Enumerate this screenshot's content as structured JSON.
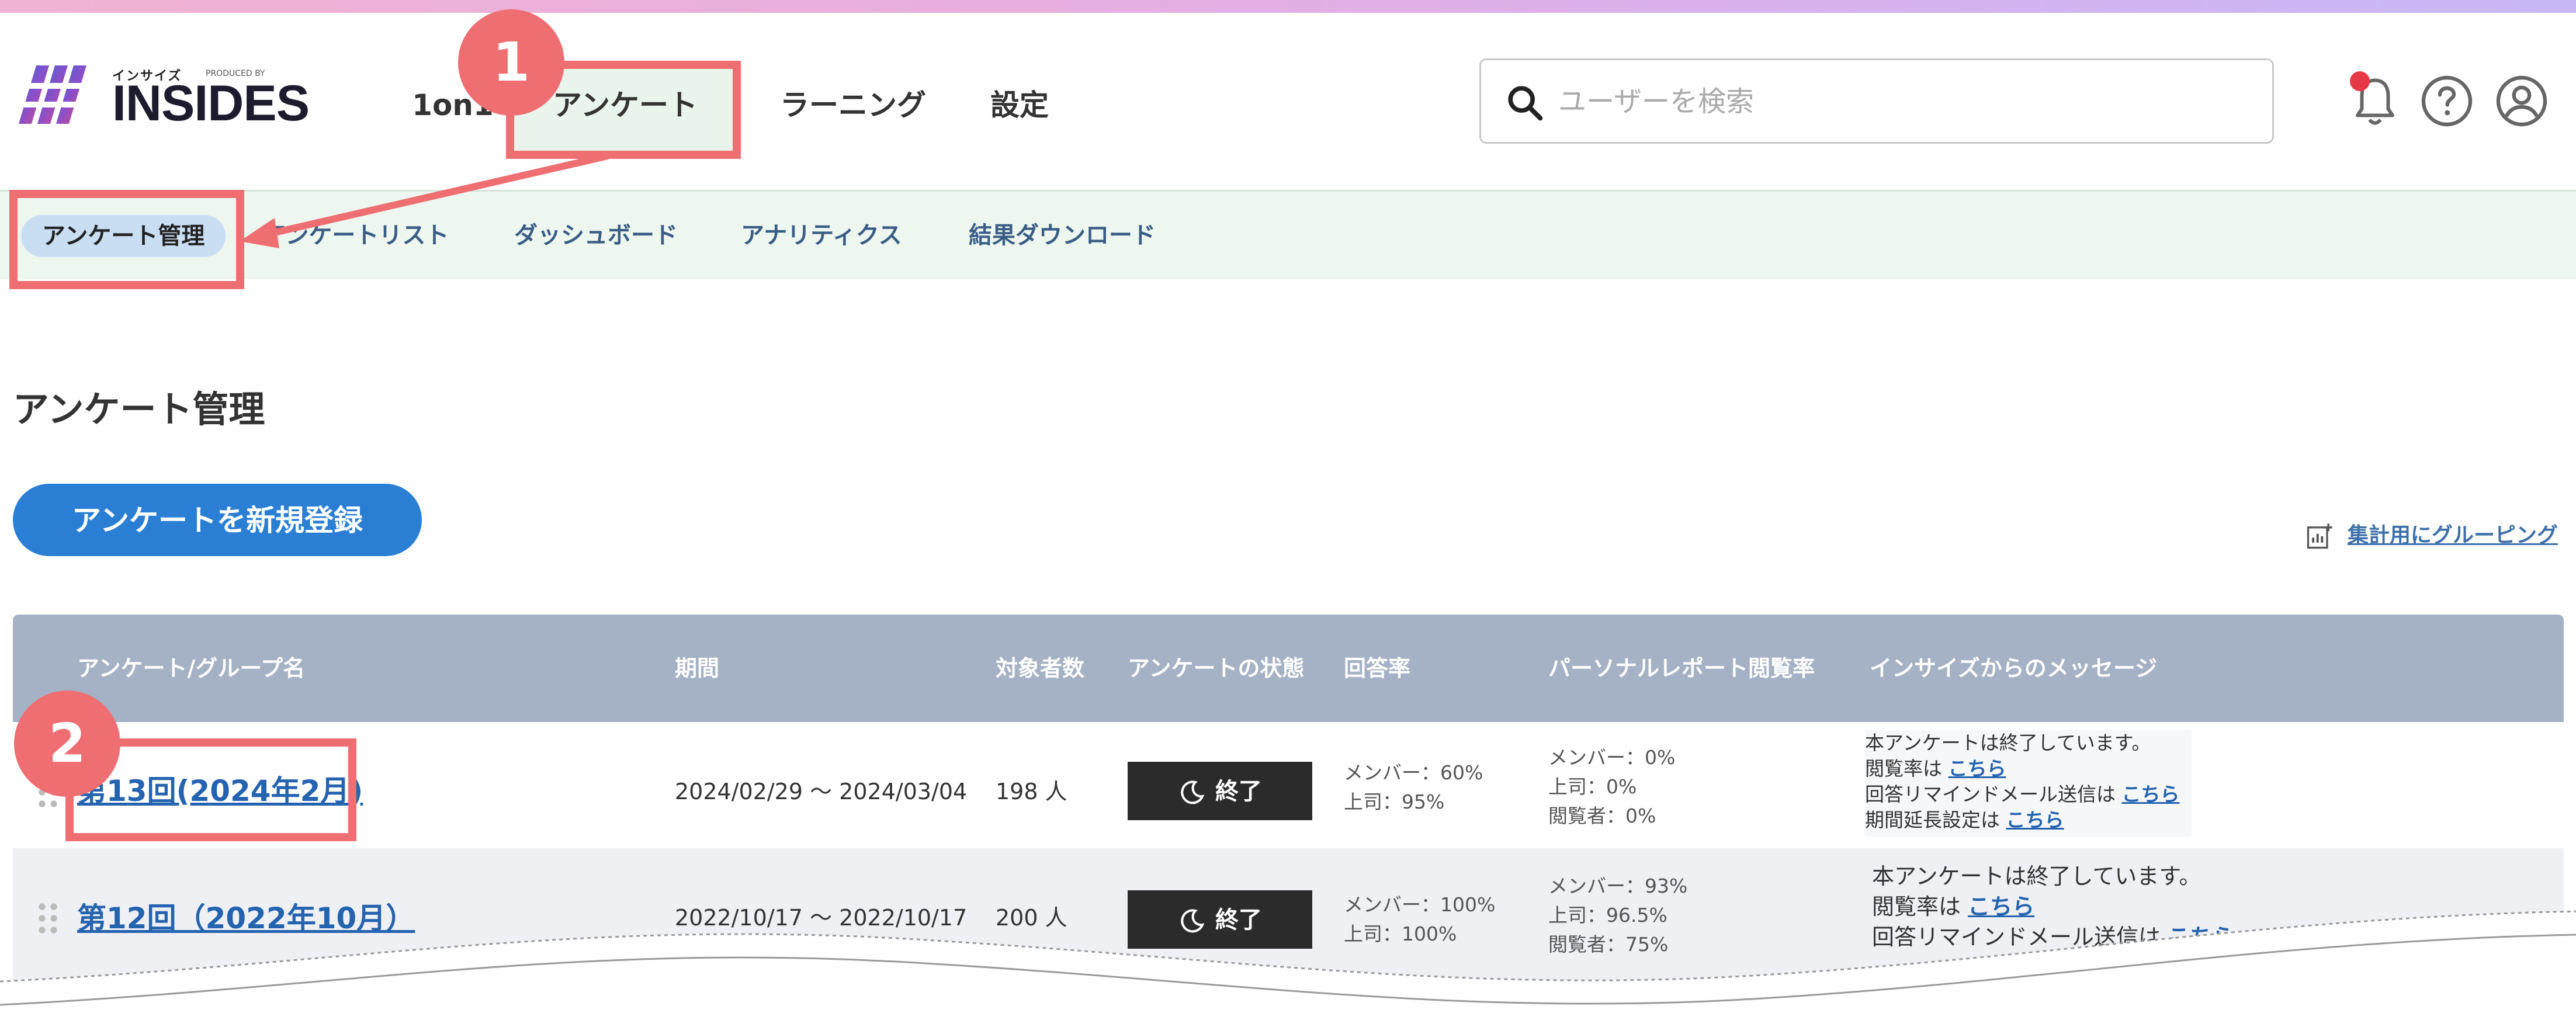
{
  "header": {
    "logo_small": "インサイズ",
    "logo_produced": "PRODUCED BY",
    "logo_name": "INSIDES",
    "nav": [
      "1on1",
      "アンケート",
      "ラーニング",
      "設定"
    ],
    "search_placeholder": "ユーザーを検索"
  },
  "subnav": {
    "items": [
      "アンケート管理",
      "アンケートリスト",
      "ダッシュボード",
      "アナリティクス",
      "結果ダウンロード"
    ]
  },
  "page": {
    "title": "アンケート管理",
    "new_button": "アンケートを新規登録",
    "group_link": "集計用にグルーピング"
  },
  "table": {
    "headers": [
      "アンケート/グループ名",
      "期間",
      "対象者数",
      "アンケートの状態",
      "回答率",
      "パーソナルレポート閲覧率",
      "インサイズからのメッセージ"
    ],
    "rows": [
      {
        "name": "第13回(2024年2月)",
        "period": "2024/02/29 ～ 2024/03/04",
        "count": "198 人",
        "status": "終了",
        "answer_rate": [
          "メンバー：60%",
          "上司：95%"
        ],
        "report_rate": [
          "メンバー：0%",
          "上司：0%",
          "閲覧者：0%"
        ],
        "message": {
          "line1": "本アンケートは終了しています。",
          "line2_prefix": "閲覧率は",
          "line2_link": "こちら",
          "line3_prefix": "回答リマインドメール送信は",
          "line3_link": "こちら",
          "line4_prefix": "期間延長設定は",
          "line4_link": "こちら"
        }
      },
      {
        "name": "第12回（2022年10月）",
        "period": "2022/10/17 ～ 2022/10/17",
        "count": "200 人",
        "status": "終了",
        "answer_rate": [
          "メンバー：100%",
          "上司：100%"
        ],
        "report_rate": [
          "メンバー：93%",
          "上司：96.5%",
          "閲覧者：75%"
        ],
        "message": {
          "line1": "本アンケートは終了しています。",
          "line2_prefix": "閲覧率は",
          "line2_link": "こちら",
          "line3_prefix": "回答リマインドメール送信は",
          "line3_link": "こちら"
        }
      }
    ]
  },
  "annotations": {
    "badge1": "1",
    "badge2": "2"
  },
  "colors": {
    "accent": "#2a7fd4",
    "annotation": "#ee6e72",
    "table_header": "#a5b1c4",
    "subnav_bg": "#eef7ef"
  }
}
